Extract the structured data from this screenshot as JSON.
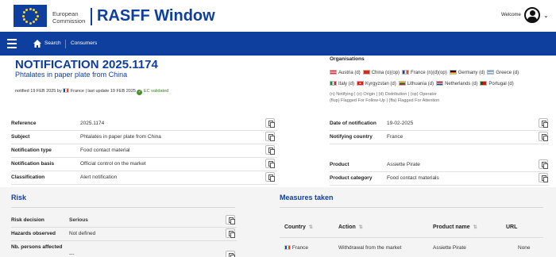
{
  "header": {
    "ec_line1": "European",
    "ec_line2": "Commission",
    "app_title": "RASFF Window",
    "welcome": "Welcome"
  },
  "nav": {
    "search": "Search",
    "consumers": "Consumers"
  },
  "notification": {
    "title": "NOTIFICATION 2025.1174",
    "subtitle": "Phtalates in paper plate from China",
    "notified_prefix": "notified 19 FEB 2025 by",
    "notified_country": "France",
    "last_update": "| last update 19 FEB 2025",
    "ec_validated": "EC validated"
  },
  "organisations": {
    "title": "Organisations",
    "row1": [
      {
        "name": "Austria (d)",
        "flag": "austria"
      },
      {
        "name": "China (o)(op)",
        "flag": "china"
      },
      {
        "name": "France (n)(d)(op)",
        "flag": "france"
      },
      {
        "name": "Germany (d)",
        "flag": "germany"
      },
      {
        "name": "Greece (d)",
        "flag": "greece"
      }
    ],
    "row2": [
      {
        "name": "Italy (d)",
        "flag": "italy"
      },
      {
        "name": "Kyrgyzstan (d)",
        "flag": "kyrgyzstan"
      },
      {
        "name": "Lithuania (d)",
        "flag": "lithuania"
      },
      {
        "name": "Netherlands (d)",
        "flag": "netherlands"
      },
      {
        "name": "Portugal (d)",
        "flag": "portugal"
      }
    ],
    "legend1": "(n) Notifying | (o) Origin | (d) Distribution | (op) Operator",
    "legend2": "(flup) Flagged For Follow-Up | (ffa) Flagged For Attention"
  },
  "details_left": [
    {
      "label": "Reference",
      "value": "2025.1174"
    },
    {
      "label": "Subject",
      "value": "Phtalates in paper plate from China"
    },
    {
      "label": "Notification type",
      "value": "Food contact material"
    },
    {
      "label": "Notification basis",
      "value": "Official control on the market"
    },
    {
      "label": "Classification",
      "value": "Alert notification"
    }
  ],
  "details_right": [
    {
      "label": "Date of notification",
      "value": "19-02-2025"
    },
    {
      "label": "Notifying country",
      "value": "France"
    },
    {
      "label": "Product",
      "value": "Assiette Pirate"
    },
    {
      "label": "Product category",
      "value": "Food contact materials"
    }
  ],
  "risk": {
    "title": "Risk",
    "rows": [
      {
        "label": "Risk decision",
        "value": "Serious"
      },
      {
        "label": "Hazards observed",
        "value": "Not defined"
      },
      {
        "label": "Nb. persons affected",
        "value": "---"
      }
    ]
  },
  "measures": {
    "title": "Measures taken",
    "columns": [
      "Country",
      "Action",
      "Product name",
      "URL"
    ],
    "rows": [
      {
        "country": "France",
        "action": "Withdrawal from the market",
        "product": "Assiette Pirate",
        "url": "None"
      }
    ]
  },
  "colors": {
    "brand_blue": "#0e3f9e",
    "serious_red": "#d0021b",
    "validated_green": "#3a7d1c"
  }
}
